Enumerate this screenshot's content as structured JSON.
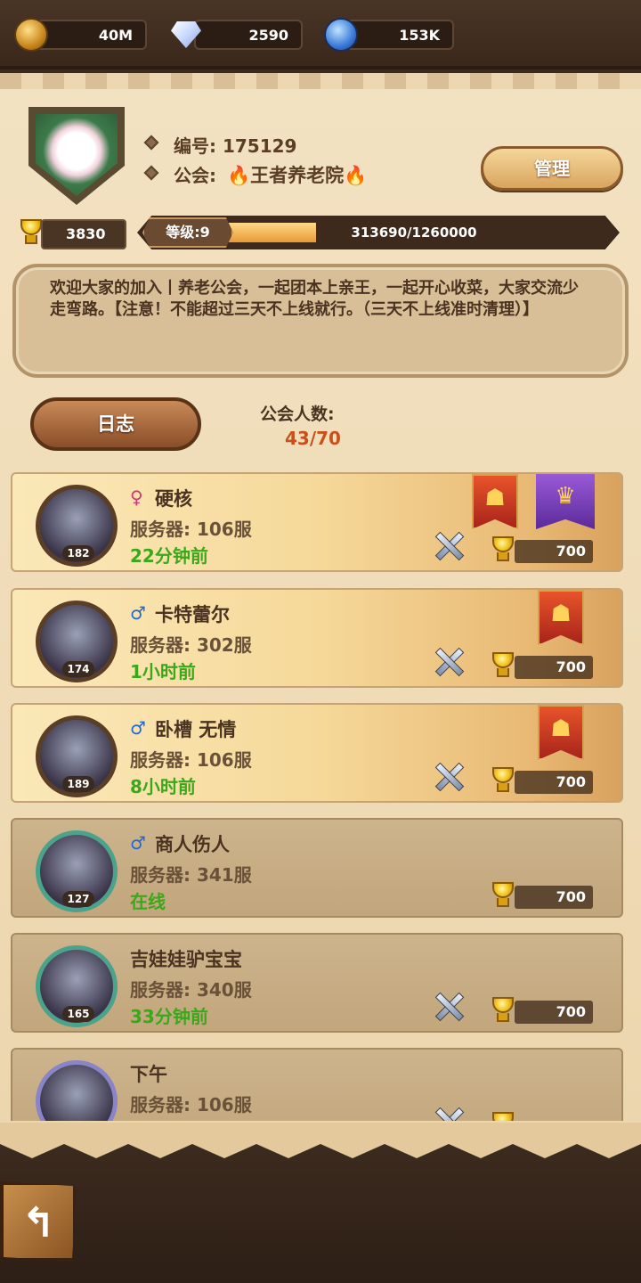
{
  "resources": {
    "gold": "40M",
    "diamonds": "2590",
    "dust": "153K"
  },
  "guild": {
    "id_label": "编号: 175129",
    "name_label": "公会:",
    "name": "王者养老院",
    "manage_label": "管理",
    "trophies": "3830",
    "level_label": "等级:9",
    "exp_text": "313690/1260000",
    "exp_fraction": 0.249,
    "notice": "欢迎大家的加入丨养老公会，一起团本上亲王，一起开心收菜，大家交流少走弯路。【注意！不能超过三天不上线就行。（三天不上线准时清理）】",
    "log_label": "日志",
    "members_label": "公会人数:",
    "members_count": "43/70"
  },
  "members": [
    {
      "name": "硬核",
      "gender": "♀",
      "level": "182",
      "server": "服务器: 106服",
      "seen": "22分钟前",
      "points": "700"
    },
    {
      "name": "卡特蕾尔",
      "gender": "♂",
      "level": "174",
      "server": "服务器: 302服",
      "seen": "1小时前",
      "points": "700"
    },
    {
      "name": "卧槽 无情",
      "gender": "♂",
      "level": "189",
      "server": "服务器: 106服",
      "seen": "8小时前",
      "points": "700"
    },
    {
      "name": "商人伤人",
      "gender": "♂",
      "level": "127",
      "server": "服务器: 341服",
      "seen": "在线",
      "points": "700"
    },
    {
      "name": "吉娃娃驴宝宝",
      "gender": "",
      "level": "165",
      "server": "服务器: 340服",
      "seen": "33分钟前",
      "points": "700"
    },
    {
      "name": "下午",
      "gender": "",
      "level": "",
      "server": "服务器: 106服",
      "seen": "",
      "points": ""
    }
  ],
  "icons": {
    "gold": "gold-coin-icon",
    "diamond": "diamond-icon",
    "dust": "dust-crystal-icon",
    "trophy": "trophy-icon",
    "swords": "crossed-swords-icon",
    "banner_red": "red-banner-icon",
    "banner_purple": "purple-crown-banner-icon",
    "back": "back-arrow-icon"
  }
}
